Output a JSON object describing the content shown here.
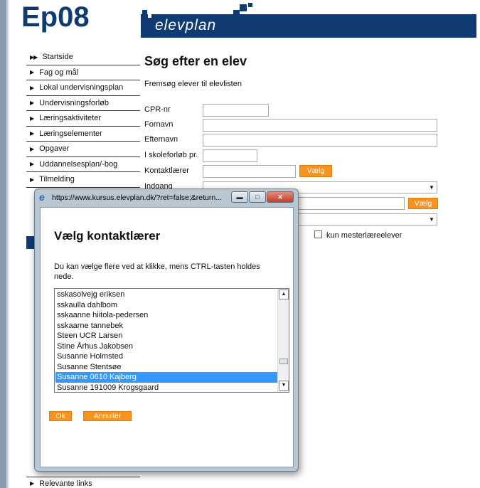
{
  "site_title": "Ep08",
  "logo_text": "elevplan",
  "nav": {
    "items": [
      "Startside",
      "Fag og mål",
      "Lokal undervisningsplan",
      "Undervisningsforløb",
      "Læringsaktiviteter",
      "Læringselementer",
      "Opgaver",
      "Uddannelsesplan/-bog",
      "Tilmelding"
    ],
    "relevante_links": "Relevante links"
  },
  "page": {
    "title": "Søg efter en elev",
    "subtitle": "Fremsøg elever til elevlisten"
  },
  "form": {
    "cpr_label": "CPR-nr",
    "fornavn_label": "Fornavn",
    "efternavn_label": "Efternavn",
    "skoleforloeb_label": "I skoleforløb pr.",
    "kontaktlaerer_label": "Kontaktlærer",
    "indgang_label": "Indgang",
    "vaelg_label": "Vælg",
    "mesterlaere_label": "kun mesterlæreelever"
  },
  "popup": {
    "window_title": "https://www.kursus.elevplan.dk/?ret=false;&return...",
    "heading": "Vælg kontaktlærer",
    "info": "Du kan vælge flere ved at klikke, mens CTRL-tasten holdes nede.",
    "options": [
      "sskasolvejg eriksen",
      "sskaulla dahlbom",
      "sskaanne hiitola-pedersen",
      "sskaarne tannebek",
      "Steen UCR Larsen",
      "Stine Århus Jakobsen",
      "Susanne Holmsted",
      "Susanne Stentsøe",
      "Susanne 0610 Kajberg",
      "Susanne 191009 Krogsgaard"
    ],
    "selected_option": "Susanne 0610 Kajberg",
    "ok_label": "Ok",
    "cancel_label": "Annuller"
  },
  "colors": {
    "brand_blue": "#0f3b72",
    "accent_orange": "#f7931e",
    "selection_blue": "#3399ff"
  }
}
